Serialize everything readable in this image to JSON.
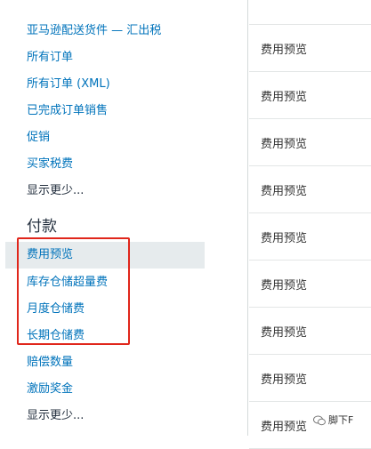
{
  "sidebar": {
    "top_clipped": "——————",
    "links_top": [
      "亚马逊配送货件 — 汇出税",
      "所有订单",
      "所有订单 (XML)",
      "已完成订单销售",
      "促销",
      "买家税费"
    ],
    "show_less_1": "显示更少...",
    "payment_heading": "付款",
    "payment_links": [
      "费用预览",
      "库存仓储超量费",
      "月度仓储费",
      "长期仓储费",
      "赔偿数量",
      "激励奖金"
    ],
    "show_less_2": "显示更少..."
  },
  "main": {
    "row_label": "费用预览",
    "rows": [
      "",
      "费用预览",
      "费用预览",
      "费用预览",
      "费用预览",
      "费用预览",
      "费用预览",
      "费用预览",
      "费用预览",
      "费用预览"
    ]
  },
  "watermark": {
    "text": "脚下F",
    "icon": "wechat-icon"
  },
  "colors": {
    "link": "#0073bb",
    "active_bg": "#e6ebed",
    "highlight": "#e0261b"
  }
}
